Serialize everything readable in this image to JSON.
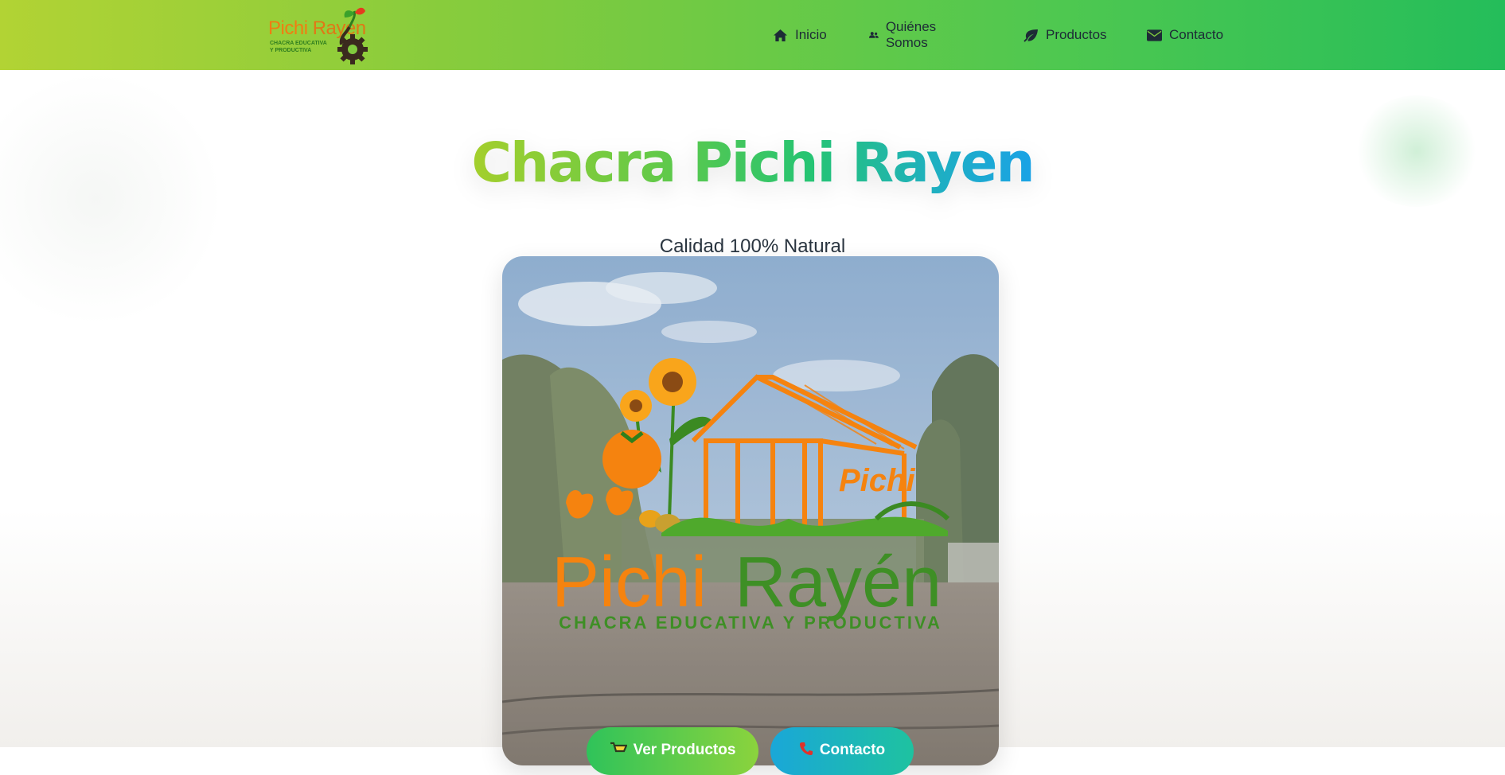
{
  "nav": {
    "logo": {
      "word1": "Pichi",
      "word2": "Rayen",
      "subtitle_line1": "CHACRA EDUCATIVA",
      "subtitle_line2": "Y PRODUCTIVA"
    },
    "items": [
      {
        "label": "Inicio",
        "icon": "home-icon"
      },
      {
        "label": "Quiénes Somos",
        "icon": "users-icon"
      },
      {
        "label": "Productos",
        "icon": "leaf-icon"
      },
      {
        "label": "Contacto",
        "icon": "envelope-icon"
      }
    ]
  },
  "hero": {
    "title": "Chacra Pichi Rayen",
    "subtitle": "Calidad 100% Natural",
    "image": {
      "brand_small": "Pichi",
      "brand_word1": "Pichi",
      "brand_word2": "Rayén",
      "tagline": "CHACRA EDUCATIVA Y PRODUCTIVA"
    },
    "buttons": {
      "products": "Ver Productos",
      "contact": "Contacto"
    }
  },
  "colors": {
    "nav_gradient_start": "#b2d334",
    "nav_gradient_end": "#24bd5a",
    "brand_orange": "#f5830f",
    "brand_green": "#3e8f25",
    "title_gradient_start": "#a4cf2c",
    "title_gradient_end": "#1aa2e6"
  }
}
